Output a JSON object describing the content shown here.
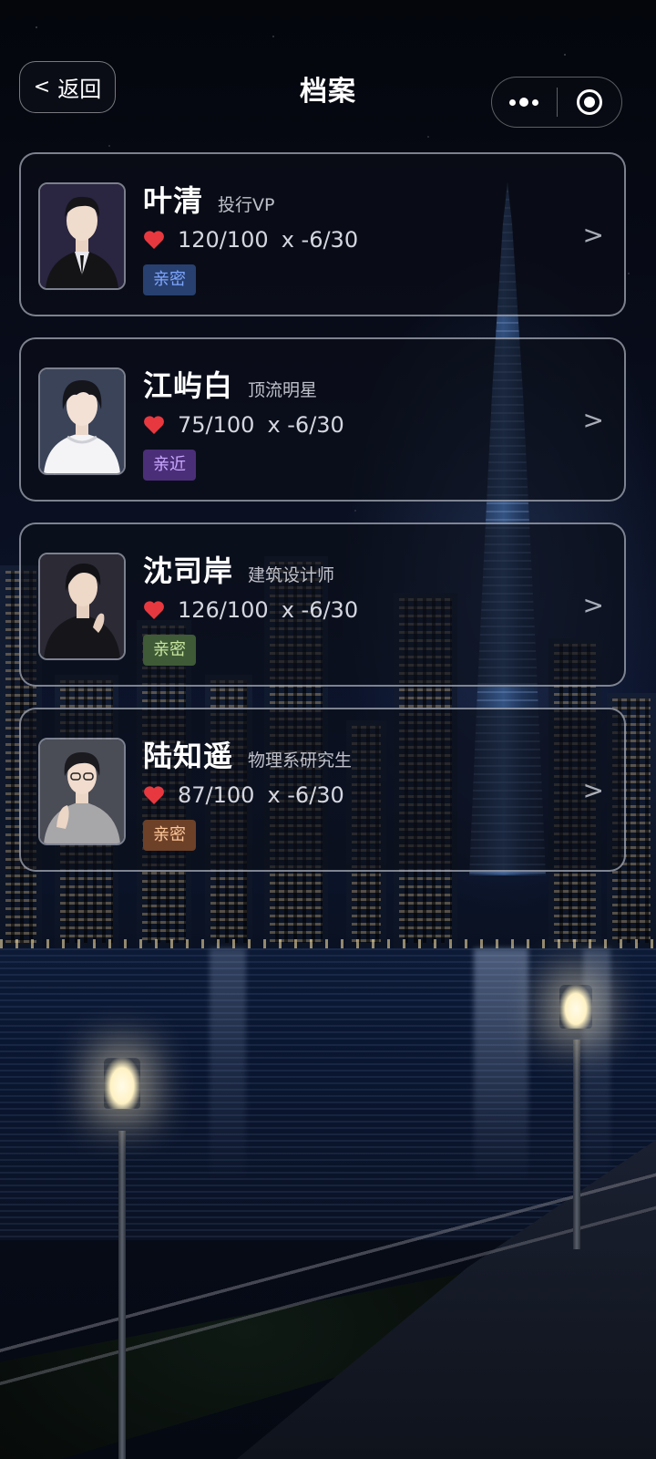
{
  "header": {
    "back_label": "返回",
    "title": "档案"
  },
  "characters": [
    {
      "name": "叶清",
      "role": "投行VP",
      "affection": "120/100",
      "modifier": "x -6/30",
      "tag": "亲密",
      "tag_color": "#7fa6ff",
      "tag_bg": "#27406f"
    },
    {
      "name": "江屿白",
      "role": "顶流明星",
      "affection": "75/100",
      "modifier": "x -6/30",
      "tag": "亲近",
      "tag_color": "#c9a8ff",
      "tag_bg": "#4b2e78"
    },
    {
      "name": "沈司岸",
      "role": "建筑设计师",
      "affection": "126/100",
      "modifier": "x -6/30",
      "tag": "亲密",
      "tag_color": "#c8e6a0",
      "tag_bg": "#3f5a36"
    },
    {
      "name": "陆知遥",
      "role": "物理系研究生",
      "affection": "87/100",
      "modifier": "x -6/30",
      "tag": "亲密",
      "tag_color": "#ffc79a",
      "tag_bg": "#6d4128"
    }
  ],
  "colors": {
    "heart": "#e8383f"
  }
}
